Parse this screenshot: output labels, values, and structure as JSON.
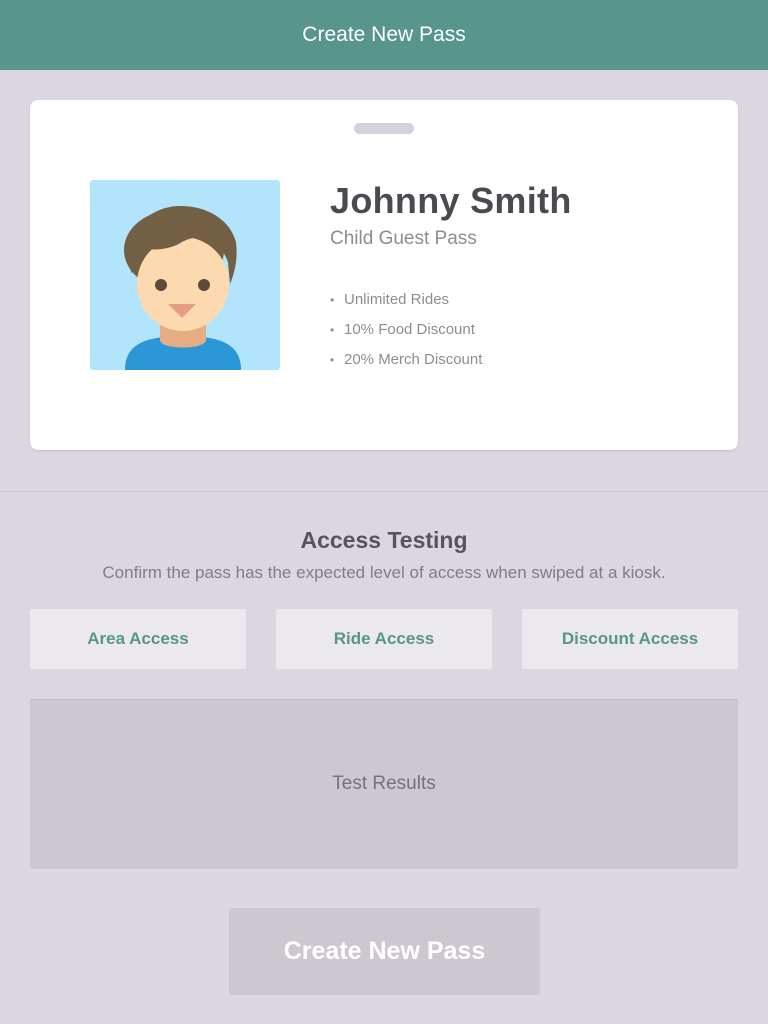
{
  "navbar": {
    "title": "Create New Pass"
  },
  "pass": {
    "name": "Johnny Smith",
    "type": "Child Guest Pass",
    "perks": [
      "Unlimited Rides",
      "10% Food Discount",
      "20% Merch Discount"
    ],
    "photo_icon": "child-avatar"
  },
  "access_testing": {
    "title": "Access Testing",
    "subtitle": "Confirm the pass has the expected level of access when swiped at a kiosk.",
    "buttons": {
      "area": "Area Access",
      "ride": "Ride Access",
      "discount": "Discount Access"
    },
    "results_placeholder": "Test Results"
  },
  "footer": {
    "create_button": "Create New Pass"
  },
  "colors": {
    "accent": "#58958a",
    "background": "#dcd6e0",
    "card": "#ffffff",
    "button_bg": "#ebe8ee",
    "results_bg": "#cdc7d0",
    "avatar_bg": "#b2e4fb"
  }
}
